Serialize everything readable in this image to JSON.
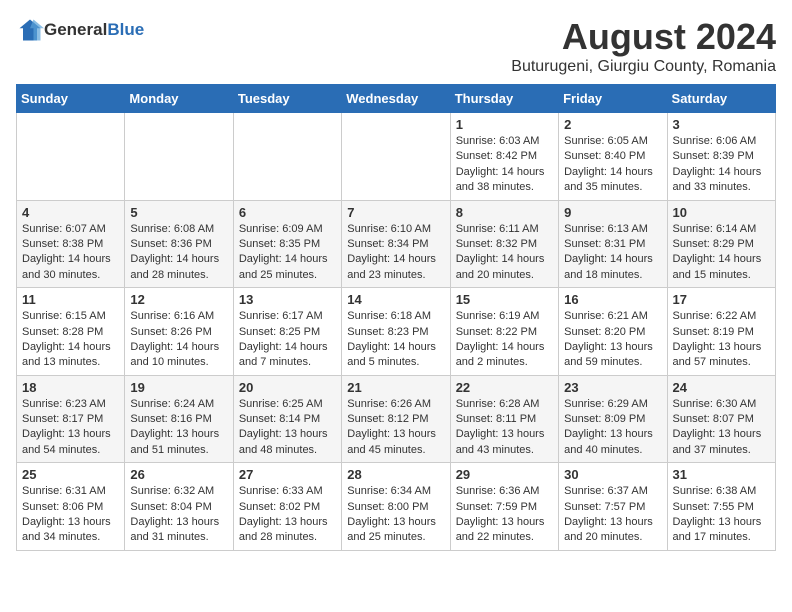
{
  "header": {
    "logo_general": "General",
    "logo_blue": "Blue",
    "month": "August 2024",
    "location": "Buturugeni, Giurgiu County, Romania"
  },
  "weekdays": [
    "Sunday",
    "Monday",
    "Tuesday",
    "Wednesday",
    "Thursday",
    "Friday",
    "Saturday"
  ],
  "weeks": [
    [
      {
        "day": "",
        "info": ""
      },
      {
        "day": "",
        "info": ""
      },
      {
        "day": "",
        "info": ""
      },
      {
        "day": "",
        "info": ""
      },
      {
        "day": "1",
        "info": "Sunrise: 6:03 AM\nSunset: 8:42 PM\nDaylight: 14 hours\nand 38 minutes."
      },
      {
        "day": "2",
        "info": "Sunrise: 6:05 AM\nSunset: 8:40 PM\nDaylight: 14 hours\nand 35 minutes."
      },
      {
        "day": "3",
        "info": "Sunrise: 6:06 AM\nSunset: 8:39 PM\nDaylight: 14 hours\nand 33 minutes."
      }
    ],
    [
      {
        "day": "4",
        "info": "Sunrise: 6:07 AM\nSunset: 8:38 PM\nDaylight: 14 hours\nand 30 minutes."
      },
      {
        "day": "5",
        "info": "Sunrise: 6:08 AM\nSunset: 8:36 PM\nDaylight: 14 hours\nand 28 minutes."
      },
      {
        "day": "6",
        "info": "Sunrise: 6:09 AM\nSunset: 8:35 PM\nDaylight: 14 hours\nand 25 minutes."
      },
      {
        "day": "7",
        "info": "Sunrise: 6:10 AM\nSunset: 8:34 PM\nDaylight: 14 hours\nand 23 minutes."
      },
      {
        "day": "8",
        "info": "Sunrise: 6:11 AM\nSunset: 8:32 PM\nDaylight: 14 hours\nand 20 minutes."
      },
      {
        "day": "9",
        "info": "Sunrise: 6:13 AM\nSunset: 8:31 PM\nDaylight: 14 hours\nand 18 minutes."
      },
      {
        "day": "10",
        "info": "Sunrise: 6:14 AM\nSunset: 8:29 PM\nDaylight: 14 hours\nand 15 minutes."
      }
    ],
    [
      {
        "day": "11",
        "info": "Sunrise: 6:15 AM\nSunset: 8:28 PM\nDaylight: 14 hours\nand 13 minutes."
      },
      {
        "day": "12",
        "info": "Sunrise: 6:16 AM\nSunset: 8:26 PM\nDaylight: 14 hours\nand 10 minutes."
      },
      {
        "day": "13",
        "info": "Sunrise: 6:17 AM\nSunset: 8:25 PM\nDaylight: 14 hours\nand 7 minutes."
      },
      {
        "day": "14",
        "info": "Sunrise: 6:18 AM\nSunset: 8:23 PM\nDaylight: 14 hours\nand 5 minutes."
      },
      {
        "day": "15",
        "info": "Sunrise: 6:19 AM\nSunset: 8:22 PM\nDaylight: 14 hours\nand 2 minutes."
      },
      {
        "day": "16",
        "info": "Sunrise: 6:21 AM\nSunset: 8:20 PM\nDaylight: 13 hours\nand 59 minutes."
      },
      {
        "day": "17",
        "info": "Sunrise: 6:22 AM\nSunset: 8:19 PM\nDaylight: 13 hours\nand 57 minutes."
      }
    ],
    [
      {
        "day": "18",
        "info": "Sunrise: 6:23 AM\nSunset: 8:17 PM\nDaylight: 13 hours\nand 54 minutes."
      },
      {
        "day": "19",
        "info": "Sunrise: 6:24 AM\nSunset: 8:16 PM\nDaylight: 13 hours\nand 51 minutes."
      },
      {
        "day": "20",
        "info": "Sunrise: 6:25 AM\nSunset: 8:14 PM\nDaylight: 13 hours\nand 48 minutes."
      },
      {
        "day": "21",
        "info": "Sunrise: 6:26 AM\nSunset: 8:12 PM\nDaylight: 13 hours\nand 45 minutes."
      },
      {
        "day": "22",
        "info": "Sunrise: 6:28 AM\nSunset: 8:11 PM\nDaylight: 13 hours\nand 43 minutes."
      },
      {
        "day": "23",
        "info": "Sunrise: 6:29 AM\nSunset: 8:09 PM\nDaylight: 13 hours\nand 40 minutes."
      },
      {
        "day": "24",
        "info": "Sunrise: 6:30 AM\nSunset: 8:07 PM\nDaylight: 13 hours\nand 37 minutes."
      }
    ],
    [
      {
        "day": "25",
        "info": "Sunrise: 6:31 AM\nSunset: 8:06 PM\nDaylight: 13 hours\nand 34 minutes."
      },
      {
        "day": "26",
        "info": "Sunrise: 6:32 AM\nSunset: 8:04 PM\nDaylight: 13 hours\nand 31 minutes."
      },
      {
        "day": "27",
        "info": "Sunrise: 6:33 AM\nSunset: 8:02 PM\nDaylight: 13 hours\nand 28 minutes."
      },
      {
        "day": "28",
        "info": "Sunrise: 6:34 AM\nSunset: 8:00 PM\nDaylight: 13 hours\nand 25 minutes."
      },
      {
        "day": "29",
        "info": "Sunrise: 6:36 AM\nSunset: 7:59 PM\nDaylight: 13 hours\nand 22 minutes."
      },
      {
        "day": "30",
        "info": "Sunrise: 6:37 AM\nSunset: 7:57 PM\nDaylight: 13 hours\nand 20 minutes."
      },
      {
        "day": "31",
        "info": "Sunrise: 6:38 AM\nSunset: 7:55 PM\nDaylight: 13 hours\nand 17 minutes."
      }
    ]
  ]
}
